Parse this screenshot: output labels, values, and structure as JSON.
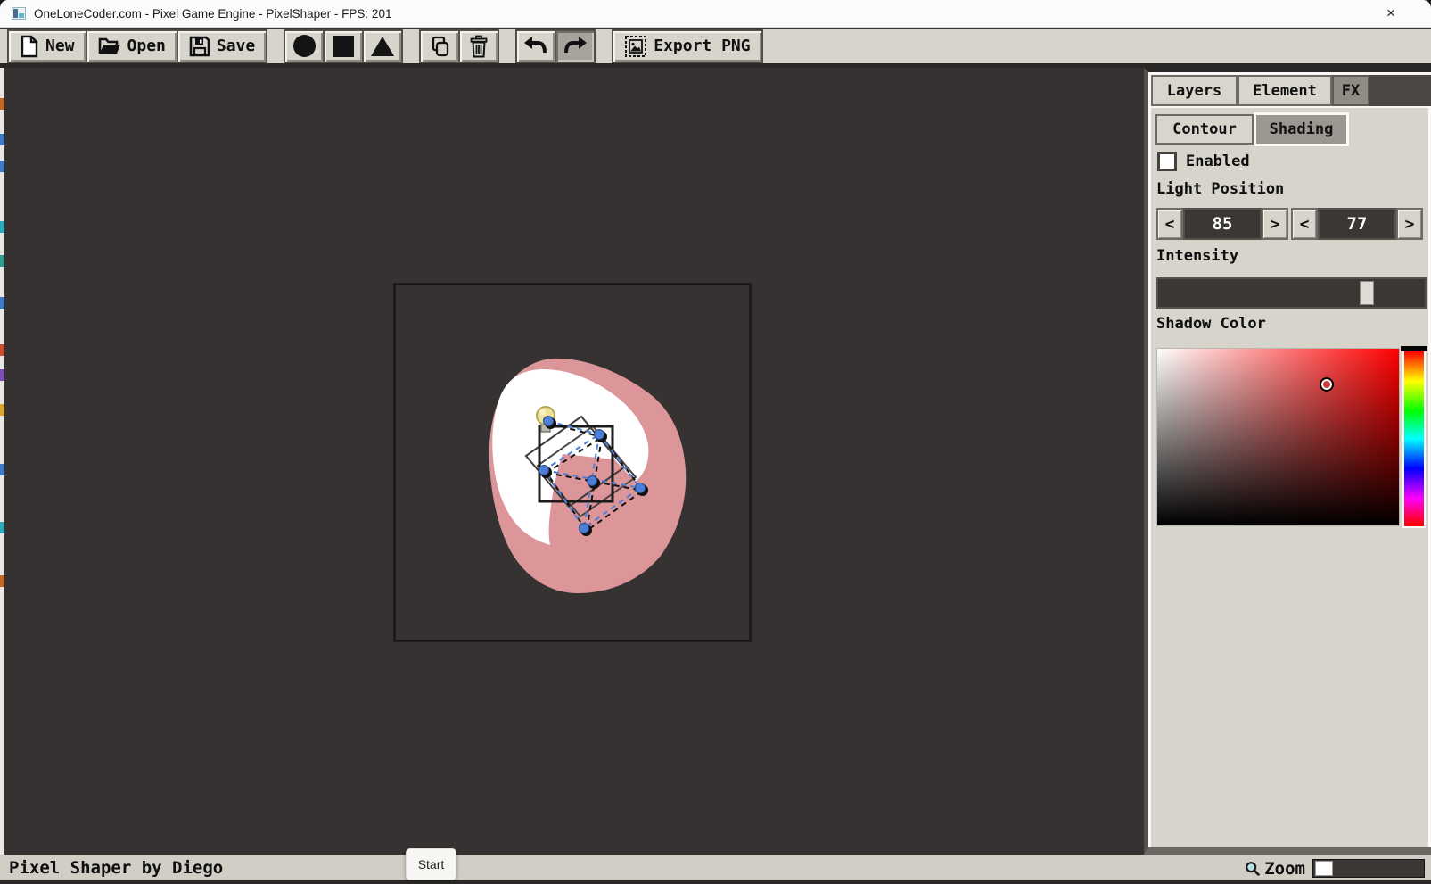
{
  "window": {
    "title": "OneLoneCoder.com - Pixel Game Engine - PixelShaper - FPS: 201"
  },
  "glyphs": {
    "close": "×",
    "chevron_left": "<",
    "chevron_right": ">"
  },
  "toolbar": {
    "file_buttons": [
      {
        "label": "New"
      },
      {
        "label": "Open"
      },
      {
        "label": "Save"
      }
    ],
    "export_label": "Export PNG"
  },
  "panel": {
    "tabs": [
      {
        "label": "Layers",
        "active": false
      },
      {
        "label": "Element",
        "active": false
      },
      {
        "label": "FX",
        "active": true
      }
    ],
    "subtabs": [
      {
        "label": "Contour",
        "active": false
      },
      {
        "label": "Shading",
        "active": true
      }
    ],
    "enabled": {
      "label": "Enabled",
      "checked": false
    },
    "light_position": {
      "label": "Light Position",
      "x": "85",
      "y": "77"
    },
    "intensity": {
      "label": "Intensity",
      "value_pct": 75
    },
    "shadow_color": {
      "label": "Shadow Color",
      "selected_hue": "#ff0000"
    }
  },
  "statusbar": {
    "app_credit": "Pixel Shaper by Diego",
    "start_label": "Start",
    "zoom_label": "Zoom"
  },
  "colors": {
    "canvas_bg": "#363232",
    "panel_bg": "#d7d4cc",
    "selected_tab_bg": "#8f8c86",
    "dark_widget_bg": "#3a3734",
    "toolbar_divider": "#2b2927",
    "blob_pink": "#dc9599",
    "blob_highlight": "#ffffff",
    "handle_blue": "#4d7fd6",
    "bulb_yellow": "#eee29a"
  },
  "left_edge_artifacts": {
    "a1": "top:34px;background:#c06a28",
    "a2": "top:74px;background:#3f78c8",
    "a3": "top:104px;background:#3f78c8",
    "a4": "top:172px;background:#2fa8b8",
    "a5": "top:210px;background:#2f9e8e",
    "a6": "top:257px;background:#3f78c8",
    "a7": "top:310px;background:#c8502f",
    "a8": "top:338px;background:#7a4fb0",
    "a9": "top:377px;background:#d8a62f",
    "a10": "top:444px;background:#3f78c8",
    "a11": "top:509px;background:#2fa8b8",
    "a12": "top:569px;background:#c06a28"
  }
}
